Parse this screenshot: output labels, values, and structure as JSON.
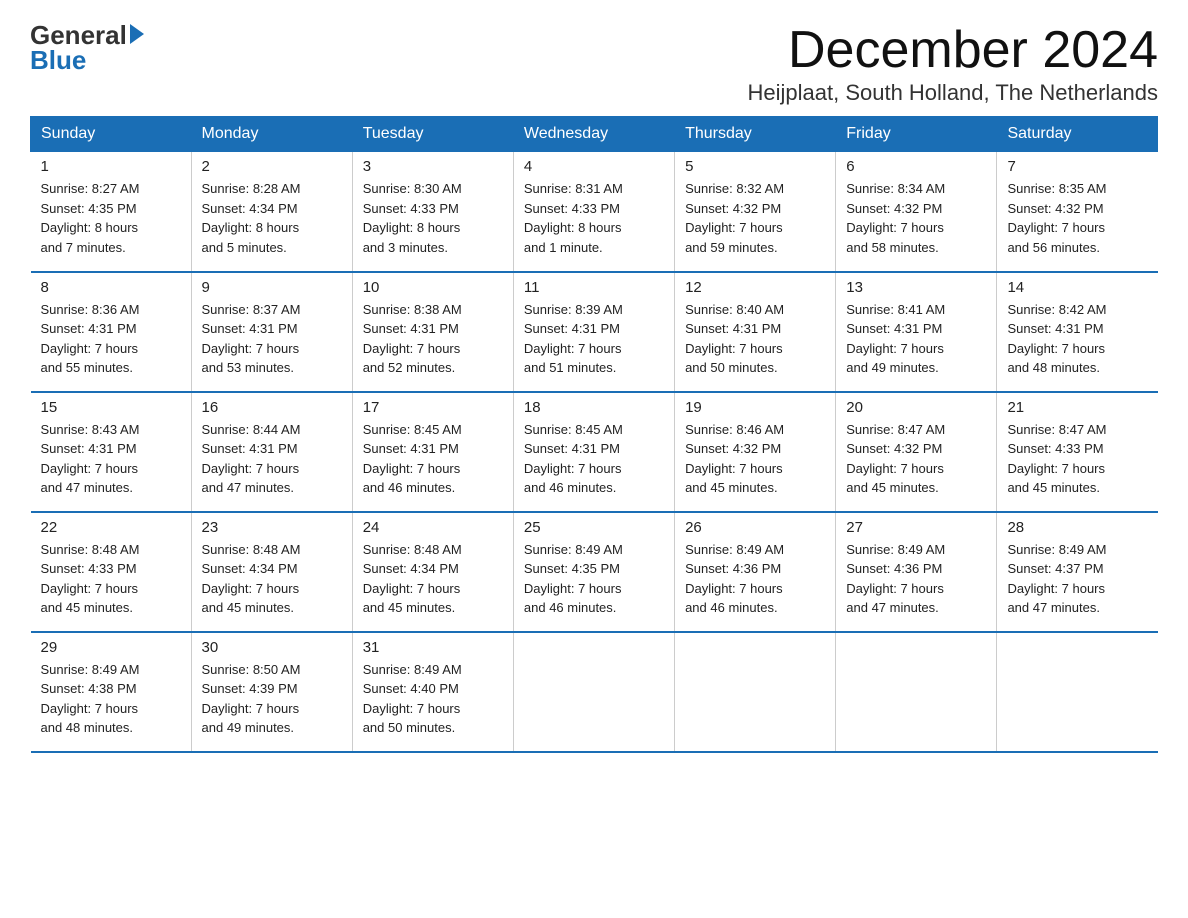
{
  "header": {
    "logo_general": "General",
    "logo_blue": "Blue",
    "month_title": "December 2024",
    "location": "Heijplaat, South Holland, The Netherlands"
  },
  "days_of_week": [
    "Sunday",
    "Monday",
    "Tuesday",
    "Wednesday",
    "Thursday",
    "Friday",
    "Saturday"
  ],
  "weeks": [
    [
      {
        "day": "1",
        "sunrise": "8:27 AM",
        "sunset": "4:35 PM",
        "daylight_hours": "8",
        "daylight_minutes": "7"
      },
      {
        "day": "2",
        "sunrise": "8:28 AM",
        "sunset": "4:34 PM",
        "daylight_hours": "8",
        "daylight_minutes": "5"
      },
      {
        "day": "3",
        "sunrise": "8:30 AM",
        "sunset": "4:33 PM",
        "daylight_hours": "8",
        "daylight_minutes": "3"
      },
      {
        "day": "4",
        "sunrise": "8:31 AM",
        "sunset": "4:33 PM",
        "daylight_hours": "8",
        "daylight_minutes": "1"
      },
      {
        "day": "5",
        "sunrise": "8:32 AM",
        "sunset": "4:32 PM",
        "daylight_hours": "7",
        "daylight_minutes": "59"
      },
      {
        "day": "6",
        "sunrise": "8:34 AM",
        "sunset": "4:32 PM",
        "daylight_hours": "7",
        "daylight_minutes": "58"
      },
      {
        "day": "7",
        "sunrise": "8:35 AM",
        "sunset": "4:32 PM",
        "daylight_hours": "7",
        "daylight_minutes": "56"
      }
    ],
    [
      {
        "day": "8",
        "sunrise": "8:36 AM",
        "sunset": "4:31 PM",
        "daylight_hours": "7",
        "daylight_minutes": "55"
      },
      {
        "day": "9",
        "sunrise": "8:37 AM",
        "sunset": "4:31 PM",
        "daylight_hours": "7",
        "daylight_minutes": "53"
      },
      {
        "day": "10",
        "sunrise": "8:38 AM",
        "sunset": "4:31 PM",
        "daylight_hours": "7",
        "daylight_minutes": "52"
      },
      {
        "day": "11",
        "sunrise": "8:39 AM",
        "sunset": "4:31 PM",
        "daylight_hours": "7",
        "daylight_minutes": "51"
      },
      {
        "day": "12",
        "sunrise": "8:40 AM",
        "sunset": "4:31 PM",
        "daylight_hours": "7",
        "daylight_minutes": "50"
      },
      {
        "day": "13",
        "sunrise": "8:41 AM",
        "sunset": "4:31 PM",
        "daylight_hours": "7",
        "daylight_minutes": "49"
      },
      {
        "day": "14",
        "sunrise": "8:42 AM",
        "sunset": "4:31 PM",
        "daylight_hours": "7",
        "daylight_minutes": "48"
      }
    ],
    [
      {
        "day": "15",
        "sunrise": "8:43 AM",
        "sunset": "4:31 PM",
        "daylight_hours": "7",
        "daylight_minutes": "47"
      },
      {
        "day": "16",
        "sunrise": "8:44 AM",
        "sunset": "4:31 PM",
        "daylight_hours": "7",
        "daylight_minutes": "47"
      },
      {
        "day": "17",
        "sunrise": "8:45 AM",
        "sunset": "4:31 PM",
        "daylight_hours": "7",
        "daylight_minutes": "46"
      },
      {
        "day": "18",
        "sunrise": "8:45 AM",
        "sunset": "4:31 PM",
        "daylight_hours": "7",
        "daylight_minutes": "46"
      },
      {
        "day": "19",
        "sunrise": "8:46 AM",
        "sunset": "4:32 PM",
        "daylight_hours": "7",
        "daylight_minutes": "45"
      },
      {
        "day": "20",
        "sunrise": "8:47 AM",
        "sunset": "4:32 PM",
        "daylight_hours": "7",
        "daylight_minutes": "45"
      },
      {
        "day": "21",
        "sunrise": "8:47 AM",
        "sunset": "4:33 PM",
        "daylight_hours": "7",
        "daylight_minutes": "45"
      }
    ],
    [
      {
        "day": "22",
        "sunrise": "8:48 AM",
        "sunset": "4:33 PM",
        "daylight_hours": "7",
        "daylight_minutes": "45"
      },
      {
        "day": "23",
        "sunrise": "8:48 AM",
        "sunset": "4:34 PM",
        "daylight_hours": "7",
        "daylight_minutes": "45"
      },
      {
        "day": "24",
        "sunrise": "8:48 AM",
        "sunset": "4:34 PM",
        "daylight_hours": "7",
        "daylight_minutes": "45"
      },
      {
        "day": "25",
        "sunrise": "8:49 AM",
        "sunset": "4:35 PM",
        "daylight_hours": "7",
        "daylight_minutes": "46"
      },
      {
        "day": "26",
        "sunrise": "8:49 AM",
        "sunset": "4:36 PM",
        "daylight_hours": "7",
        "daylight_minutes": "46"
      },
      {
        "day": "27",
        "sunrise": "8:49 AM",
        "sunset": "4:36 PM",
        "daylight_hours": "7",
        "daylight_minutes": "47"
      },
      {
        "day": "28",
        "sunrise": "8:49 AM",
        "sunset": "4:37 PM",
        "daylight_hours": "7",
        "daylight_minutes": "47"
      }
    ],
    [
      {
        "day": "29",
        "sunrise": "8:49 AM",
        "sunset": "4:38 PM",
        "daylight_hours": "7",
        "daylight_minutes": "48"
      },
      {
        "day": "30",
        "sunrise": "8:50 AM",
        "sunset": "4:39 PM",
        "daylight_hours": "7",
        "daylight_minutes": "49"
      },
      {
        "day": "31",
        "sunrise": "8:49 AM",
        "sunset": "4:40 PM",
        "daylight_hours": "7",
        "daylight_minutes": "50"
      },
      null,
      null,
      null,
      null
    ]
  ]
}
